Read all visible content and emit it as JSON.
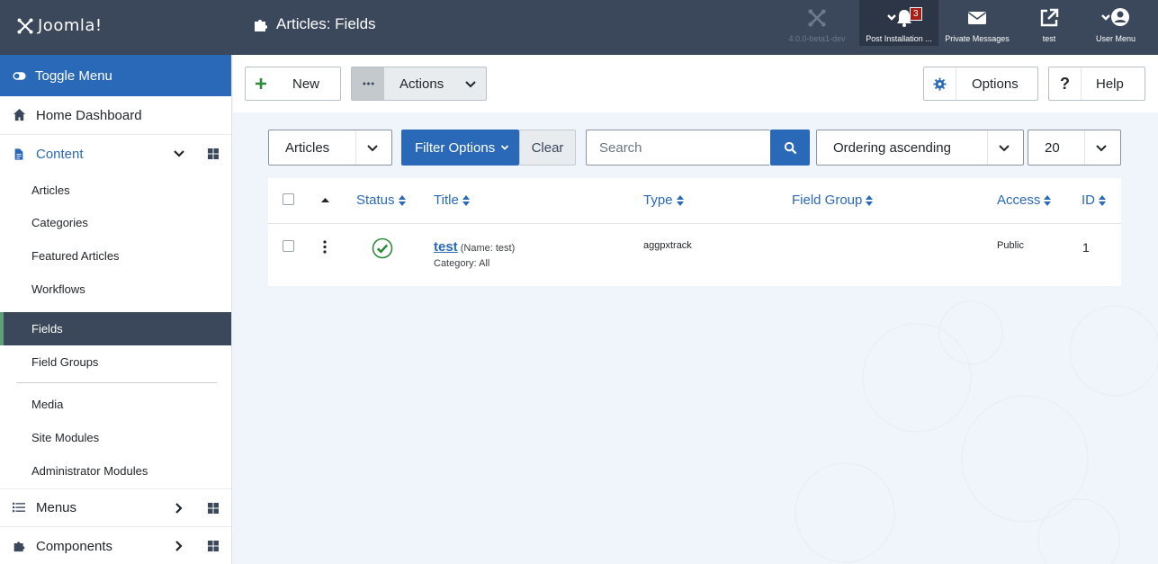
{
  "header": {
    "logo_text": "Joomla!",
    "page_title": "Articles: Fields",
    "version": "4.0.0-beta1-dev",
    "post_install_label": "Post Installation ...",
    "post_install_count": "3",
    "private_messages_label": "Private Messages",
    "site_label": "test",
    "user_menu_label": "User Menu"
  },
  "sidebar": {
    "toggle_label": "Toggle Menu",
    "home_label": "Home Dashboard",
    "content_label": "Content",
    "content_items": [
      {
        "label": "Articles"
      },
      {
        "label": "Categories"
      },
      {
        "label": "Featured Articles"
      },
      {
        "label": "Workflows"
      },
      {
        "label": "Fields",
        "active": true
      },
      {
        "label": "Field Groups"
      }
    ],
    "content_items_2": [
      {
        "label": "Media"
      },
      {
        "label": "Site Modules"
      },
      {
        "label": "Administrator Modules"
      }
    ],
    "menus_label": "Menus",
    "components_label": "Components"
  },
  "toolbar": {
    "new_label": "New",
    "actions_label": "Actions",
    "options_label": "Options",
    "help_label": "Help"
  },
  "filters": {
    "context_value": "Articles",
    "filter_options_label": "Filter Options",
    "clear_label": "Clear",
    "search_placeholder": "Search",
    "ordering_value": "Ordering ascending",
    "limit_value": "20"
  },
  "table": {
    "columns": {
      "status": "Status",
      "title": "Title",
      "type": "Type",
      "field_group": "Field Group",
      "access": "Access",
      "id": "ID"
    },
    "rows": [
      {
        "title": "test",
        "name_note": "(Name: test)",
        "category_note": "Category: All",
        "type": "aggpxtrack",
        "field_group": "",
        "access": "Public",
        "id": "1",
        "status": "published"
      }
    ]
  },
  "colors": {
    "header_bg": "#3b475a",
    "primary": "#2a69b8",
    "success": "#2f8a3b",
    "badge": "#a51f18"
  }
}
